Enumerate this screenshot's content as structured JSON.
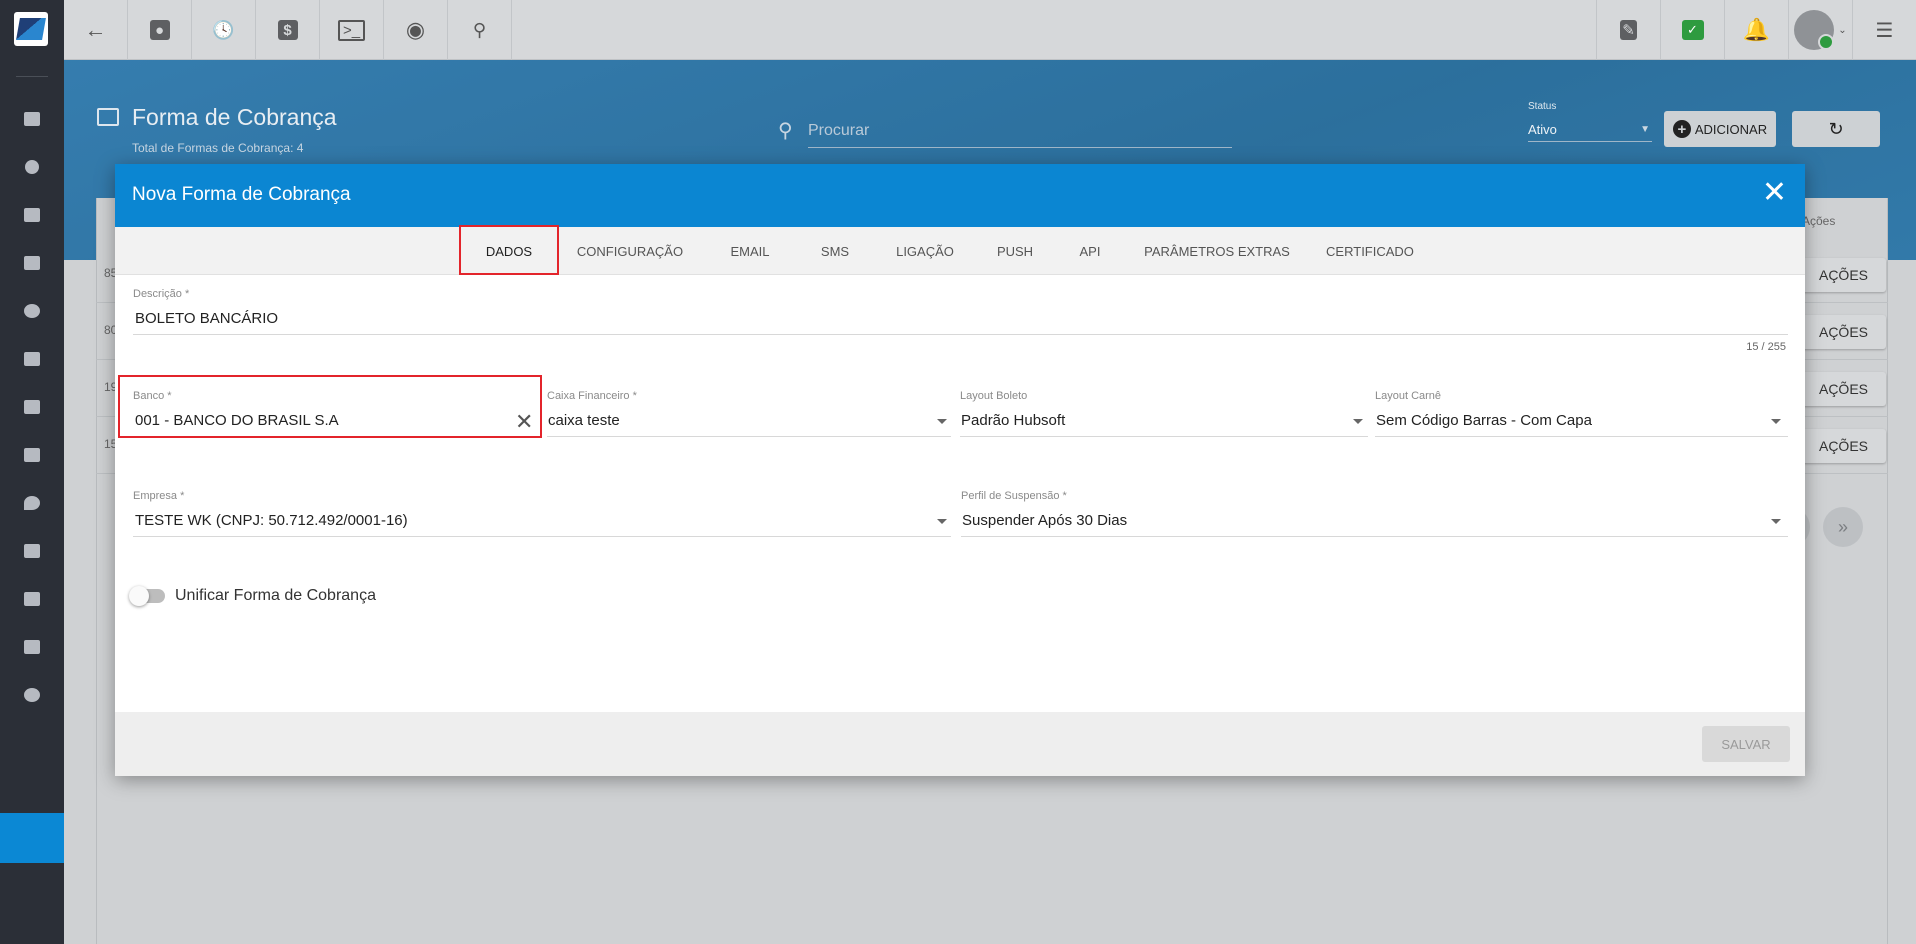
{
  "topbar": {
    "icons": [
      "back-arrow-icon",
      "contact-card-icon",
      "calendar-clock-icon",
      "dollar-icon",
      "terminal-icon",
      "eye-icon",
      "search-icon",
      "pdf-icon",
      "chat-check-icon",
      "bell-icon",
      "avatar",
      "menu-list-icon"
    ]
  },
  "header": {
    "title": "Forma de Cobrança",
    "subtitle": "Total de Formas de Cobrança: 4",
    "search_placeholder": "Procurar",
    "status_label": "Status",
    "status_value": "Ativo",
    "add_label": "ADICIONAR"
  },
  "table": {
    "actions_header": "Ações",
    "rows": [
      {
        "id_fragment": "85",
        "action_label": "AÇÕES"
      },
      {
        "id_fragment": "80",
        "action_label": "AÇÕES"
      },
      {
        "id_fragment": "19",
        "action_label": "AÇÕES"
      },
      {
        "id_fragment": "15",
        "action_label": "AÇÕES"
      }
    ]
  },
  "modal": {
    "title": "Nova Forma de Cobrança",
    "tabs": [
      "DADOS",
      "CONFIGURAÇÃO",
      "EMAIL",
      "SMS",
      "LIGAÇÃO",
      "PUSH",
      "API",
      "PARÂMETROS EXTRAS",
      "CERTIFICADO"
    ],
    "active_tab": "DADOS",
    "descricao": {
      "label": "Descrição *",
      "value": "BOLETO BANCÁRIO",
      "counter": "15 / 255"
    },
    "banco": {
      "label": "Banco *",
      "value": "001 - BANCO DO BRASIL S.A"
    },
    "caixa": {
      "label": "Caixa Financeiro *",
      "value": "caixa teste"
    },
    "layout_boleto": {
      "label": "Layout Boleto",
      "value": "Padrão Hubsoft"
    },
    "layout_carne": {
      "label": "Layout Carnê",
      "value": "Sem Código Barras - Com Capa"
    },
    "empresa": {
      "label": "Empresa *",
      "value": "TESTE WK (CNPJ: 50.712.492/0001-16)"
    },
    "perfil": {
      "label": "Perfil de Suspensão *",
      "value": "Suspender Após 30 Dias"
    },
    "unificar": {
      "label": "Unificar Forma de Cobrança",
      "checked": false
    },
    "save_label": "SALVAR"
  },
  "colors": {
    "primary": "#0b86d2",
    "highlight": "#e3242b",
    "sidebar": "#2b2f37"
  }
}
